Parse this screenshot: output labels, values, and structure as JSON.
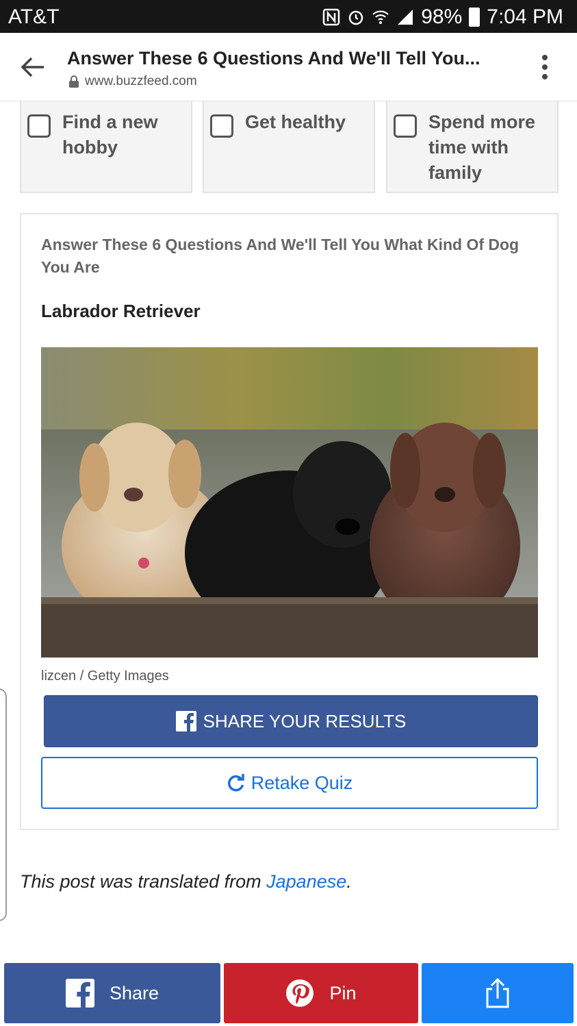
{
  "status_bar": {
    "carrier": "AT&T",
    "battery": "98%",
    "time": "7:04 PM",
    "icons": [
      "nfc-icon",
      "alarm-icon",
      "wifi-icon",
      "signal-icon",
      "battery-icon"
    ]
  },
  "browser": {
    "title": "Answer These 6 Questions And We'll Tell You...",
    "url": "www.buzzfeed.com"
  },
  "options": [
    {
      "label": "Find a new hobby",
      "checked": false
    },
    {
      "label": "Get healthy",
      "checked": false
    },
    {
      "label": "Spend more time with family",
      "checked": false
    }
  ],
  "result": {
    "quiz_title": "Answer These 6 Questions And We'll Tell You What Kind Of Dog You Are",
    "name": "Labrador Retriever",
    "credit": "lizcen / Getty Images",
    "share_label": "SHARE YOUR RESULTS",
    "retake_label": "Retake Quiz"
  },
  "translation": {
    "prefix": "This post was translated from ",
    "link": "Japanese",
    "suffix": "."
  },
  "bottom_bar": {
    "facebook_label": "Share",
    "pinterest_label": "Pin"
  },
  "colors": {
    "facebook": "#3b5998",
    "pinterest": "#c8232c",
    "share": "#1a82f5",
    "link": "#1a6fe0"
  }
}
